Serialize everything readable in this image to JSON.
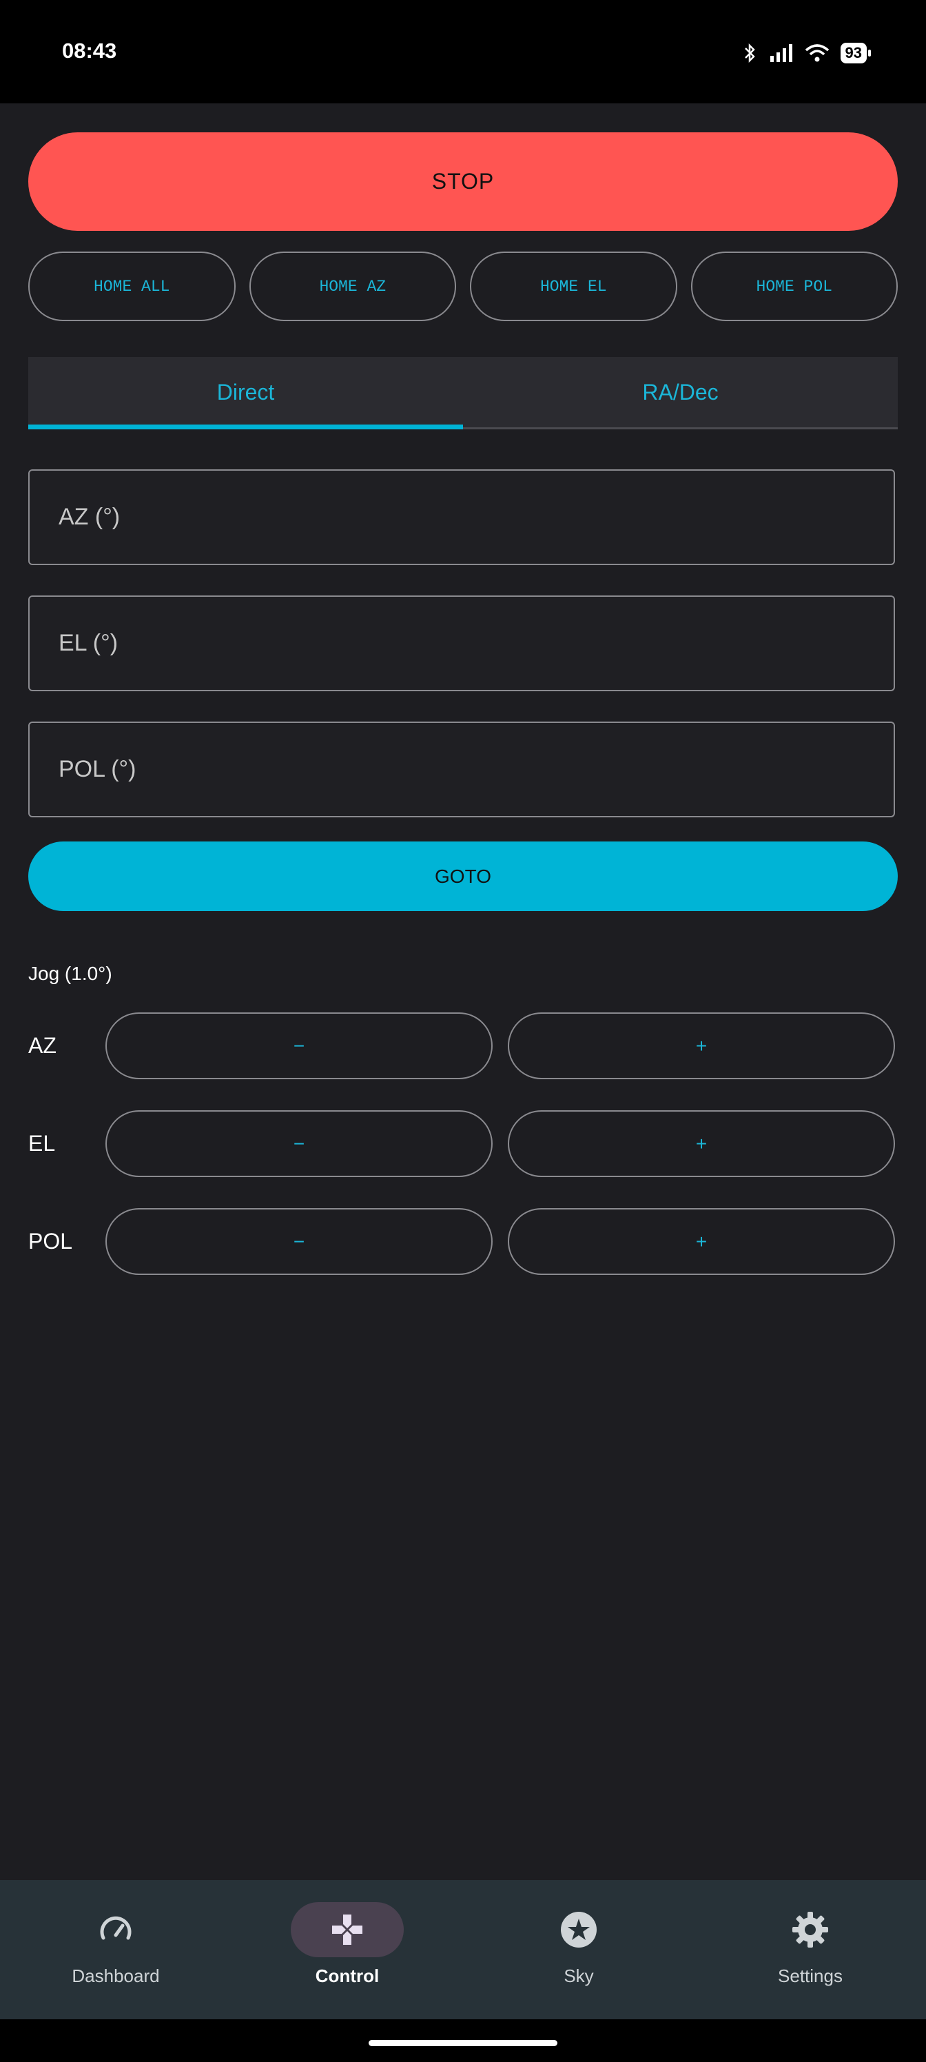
{
  "status_bar": {
    "time": "08:43",
    "battery": "93"
  },
  "controls": {
    "stop_label": "STOP",
    "home_buttons": [
      "HOME ALL",
      "HOME AZ",
      "HOME EL",
      "HOME POL"
    ]
  },
  "tabs": [
    {
      "label": "Direct",
      "active": true
    },
    {
      "label": "RA/Dec",
      "active": false
    }
  ],
  "fields": {
    "az_placeholder": "AZ (°)",
    "el_placeholder": "EL (°)",
    "pol_placeholder": "POL (°)"
  },
  "goto_label": "GOTO",
  "jog": {
    "title": "Jog (1.0°)",
    "rows": [
      {
        "label": "AZ",
        "minus": "−",
        "plus": "+"
      },
      {
        "label": "EL",
        "minus": "−",
        "plus": "+"
      },
      {
        "label": "POL",
        "minus": "−",
        "plus": "+"
      }
    ]
  },
  "bottom_nav": {
    "items": [
      {
        "label": "Dashboard",
        "icon": "speedometer-icon"
      },
      {
        "label": "Control",
        "icon": "gamepad-icon",
        "active": true
      },
      {
        "label": "Sky",
        "icon": "star-icon"
      },
      {
        "label": "Settings",
        "icon": "gear-icon"
      }
    ]
  },
  "colors": {
    "stop": "#ff5552",
    "accent": "#00b4d6",
    "background": "#1d1d21",
    "nav_background": "#273238"
  }
}
